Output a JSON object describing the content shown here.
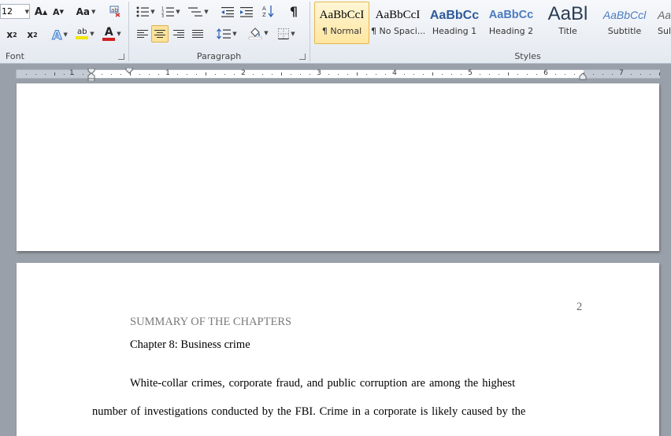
{
  "ribbon": {
    "font_group": {
      "label": "Font",
      "font_size": "12",
      "grow_font": "A",
      "shrink_font": "A",
      "change_case": "Aa",
      "subscript": "x",
      "subscript_mark": "2",
      "superscript": "x",
      "superscript_mark": "2",
      "text_effects": "A",
      "highlight": "ab",
      "font_color": "A"
    },
    "paragraph_group": {
      "label": "Paragraph",
      "show_marks": "¶"
    },
    "styles_group": {
      "label": "Styles",
      "items": [
        {
          "sample": "AaBbCcI",
          "name": "¶ Normal"
        },
        {
          "sample": "AaBbCcI",
          "name": "¶ No Spaci..."
        },
        {
          "sample": "AaBbCc",
          "name": "Heading 1"
        },
        {
          "sample": "AaBbCc",
          "name": "Heading 2"
        },
        {
          "sample": "AaBl",
          "name": "Title"
        },
        {
          "sample": "AaBbCcl",
          "name": "Subtitle"
        },
        {
          "sample": "Aa",
          "name": "Sub"
        }
      ]
    },
    "colors": {
      "highlight": "#f2e500",
      "font_color": "#d02020",
      "heading": "#3a66a8"
    }
  },
  "ruler": {
    "numbers": [
      "1",
      "1",
      "2",
      "3",
      "4",
      "5",
      "6",
      "7"
    ]
  },
  "document": {
    "page_number": "2",
    "heading": "SUMMARY OF THE CHAPTERS",
    "chapter_title": "Chapter 8: Business crime",
    "paragraph_line_1": "White-collar crimes, corporate fraud, and public corruption are among the highest",
    "paragraph_line_2": "number of investigations conducted by the FBI. Crime in a corporate is likely caused by the"
  }
}
